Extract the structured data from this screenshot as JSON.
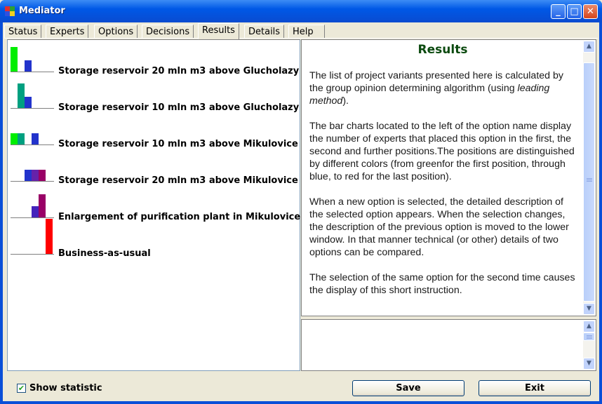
{
  "window": {
    "title": "Mediator"
  },
  "tabs": [
    {
      "label": "Status"
    },
    {
      "label": "Experts"
    },
    {
      "label": "Options"
    },
    {
      "label": "Decisions"
    },
    {
      "label": "Results",
      "active": true
    },
    {
      "label": "Details"
    },
    {
      "label": "Help"
    }
  ],
  "colors": {
    "first": "#00ee00",
    "second": "#00a080",
    "third": "#2233cc",
    "fourth": "#6622aa",
    "fifth": "#990066",
    "last": "#ff0000"
  },
  "options": [
    {
      "label": "Storage reservoir 20 mln m3 above Glucholazy"
    },
    {
      "label": "Storage reservoir 10 mln m3 above Glucholazy"
    },
    {
      "label": "Storage reservoir 10 mln m3 above Mikulovice"
    },
    {
      "label": "Storage reservoir 20 mln m3 above Mikulovice"
    },
    {
      "label": "Enlargement of purification plant in Mikulovice"
    },
    {
      "label": "Business-as-usual"
    }
  ],
  "results": {
    "title": "Results",
    "p1_a": "The list of project variants presented here is calculated by the group opinion determining algorithm (using ",
    "p1_em": "leading method",
    "p1_b": ").",
    "p2": "The bar charts located to the left of the option name display the number of experts that placed this option in the first, the second and further positions.The positions are distinguished by different colors (from greenfor the first position, through blue, to red for the last position).",
    "p3": "When a new option is selected, the detailed description of the selected option appears. When the selection changes, the description of the previous option is moved to the lower window. In that manner technical (or other) details of two options can be compared.",
    "p4": "The selection of the same option for the second time causes the display of this short instruction."
  },
  "footer": {
    "show_statistic_label": "Show statistic",
    "show_statistic_checked": true,
    "save_label": "Save",
    "exit_label": "Exit"
  }
}
